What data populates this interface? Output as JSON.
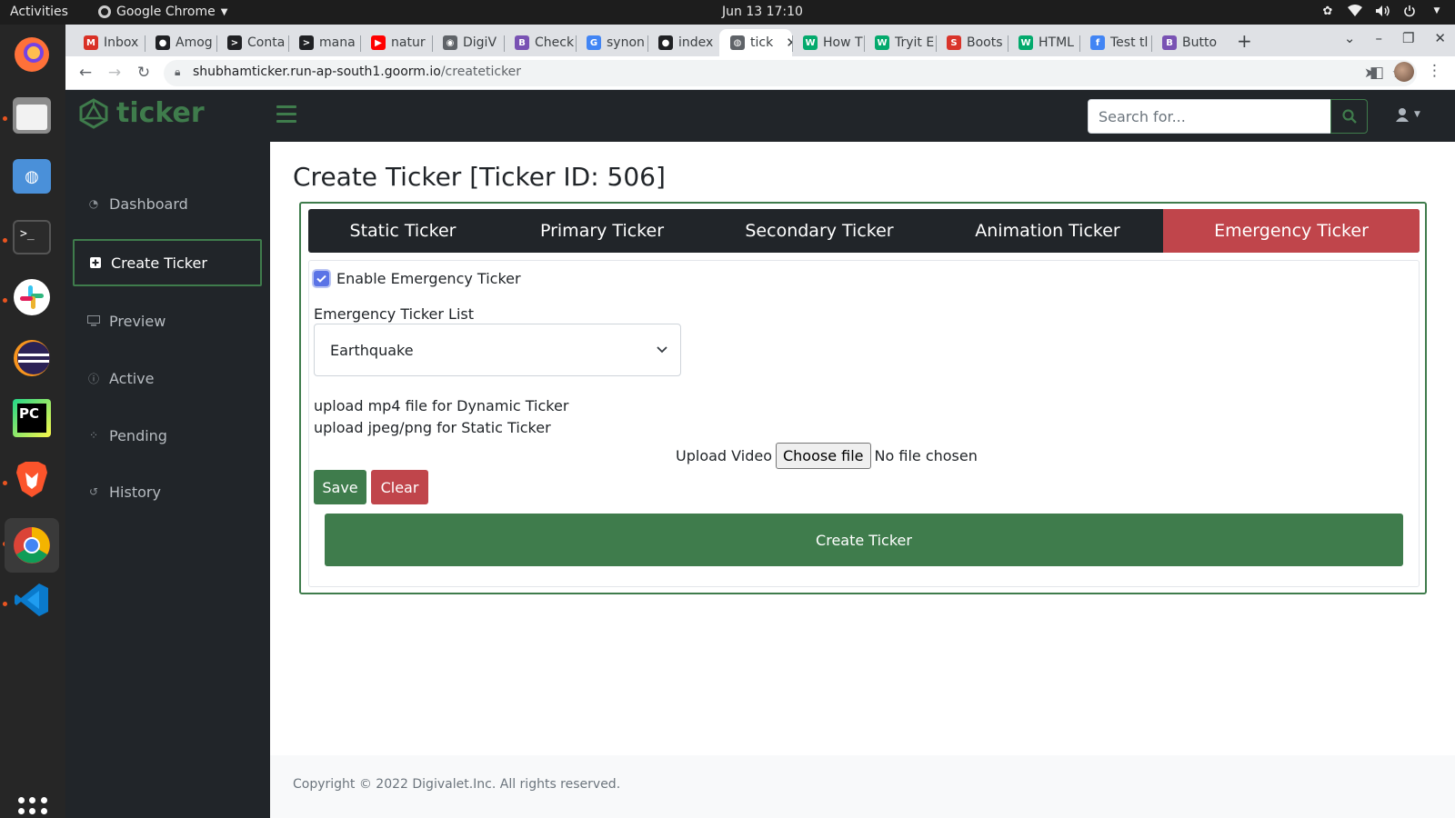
{
  "os": {
    "activities": "Activities",
    "app_name": "Google Chrome",
    "clock": "Jun 13  17:10"
  },
  "browser": {
    "tabs": [
      {
        "label": "Inbox",
        "icon": "gmail-icon",
        "color": "#d93025"
      },
      {
        "label": "Amog",
        "icon": "github-icon",
        "color": "#202124"
      },
      {
        "label": "Conta",
        "icon": "terminal-icon",
        "color": "#202124"
      },
      {
        "label": "mana",
        "icon": "terminal-icon",
        "color": "#202124"
      },
      {
        "label": "natur",
        "icon": "youtube-icon",
        "color": "#ff0000"
      },
      {
        "label": "DigiV",
        "icon": "eye-icon",
        "color": "#5f6368"
      },
      {
        "label": "Check",
        "icon": "bootstrap-icon",
        "color": "#7952b3"
      },
      {
        "label": "synon",
        "icon": "google-icon",
        "color": "#4285f4"
      },
      {
        "label": "index",
        "icon": "github-icon",
        "color": "#202124"
      },
      {
        "label": "tick",
        "icon": "globe-icon",
        "color": "#5f6368",
        "active": true
      },
      {
        "label": "How T",
        "icon": "w3schools-icon",
        "color": "#04aa6d"
      },
      {
        "label": "Tryit E",
        "icon": "w3schools-icon",
        "color": "#04aa6d"
      },
      {
        "label": "Boots",
        "icon": "s-icon",
        "color": "#d9342b"
      },
      {
        "label": "HTML",
        "icon": "w3schools-icon",
        "color": "#04aa6d"
      },
      {
        "label": "Test tl",
        "icon": "f-icon",
        "color": "#4285f4"
      },
      {
        "label": "Butto",
        "icon": "bootstrap-icon",
        "color": "#7952b3"
      }
    ],
    "url_host": "shubhamticker.run-ap-south1.goorm.io",
    "url_path": "/createticker"
  },
  "app": {
    "brand": "ticker",
    "search_placeholder": "Search for...",
    "accent_color": "#3f7c4c",
    "danger_color": "#c0454b"
  },
  "sidebar": {
    "items": [
      {
        "label": "Dashboard",
        "icon": "dashboard-icon"
      },
      {
        "label": "Create Ticker",
        "icon": "plus-square-icon",
        "active": true
      },
      {
        "label": "Preview",
        "icon": "monitor-icon"
      },
      {
        "label": "Active",
        "icon": "info-icon"
      },
      {
        "label": "Pending",
        "icon": "spinner-icon"
      },
      {
        "label": "History",
        "icon": "history-icon"
      }
    ]
  },
  "main": {
    "title": "Create Ticker [Ticker ID: 506]",
    "tabs": [
      {
        "label": "Static Ticker"
      },
      {
        "label": "Primary Ticker"
      },
      {
        "label": "Secondary Ticker"
      },
      {
        "label": "Animation Ticker"
      },
      {
        "label": "Emergency Ticker",
        "active": true
      }
    ],
    "enable_label": "Enable Emergency Ticker",
    "enable_checked": true,
    "list_label": "Emergency Ticker List",
    "list_value": "Earthquake",
    "hint_1": "upload mp4 file for Dynamic Ticker",
    "hint_2": "upload jpeg/png for Static Ticker",
    "upload_label": "Upload Video",
    "choose_file": "Choose file",
    "no_file": "No file chosen",
    "save": "Save",
    "clear": "Clear",
    "create": "Create Ticker"
  },
  "footer": {
    "copyright": "Copyright © 2022 Digivalet.Inc. All rights reserved."
  }
}
